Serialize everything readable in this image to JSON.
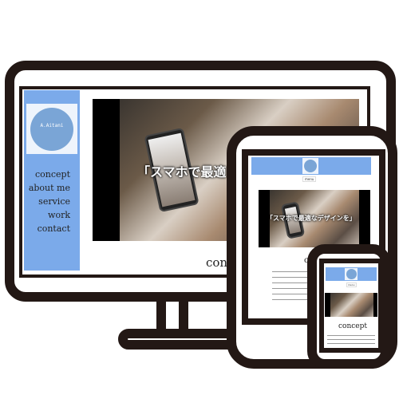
{
  "desktop": {
    "logo_text": "A.Aitani",
    "nav": [
      "concept",
      "about me",
      "service",
      "work",
      "contact"
    ],
    "hero_caption": "「スマホで最適",
    "section_title": "conc"
  },
  "tablet": {
    "menu_label": "menu",
    "hero_caption": "「スマホで最適なデザインを」",
    "section_title": "co"
  },
  "phone": {
    "menu_label": "menu",
    "section_title": "concept"
  },
  "colors": {
    "frame": "#231815",
    "accent": "#7baaea"
  }
}
